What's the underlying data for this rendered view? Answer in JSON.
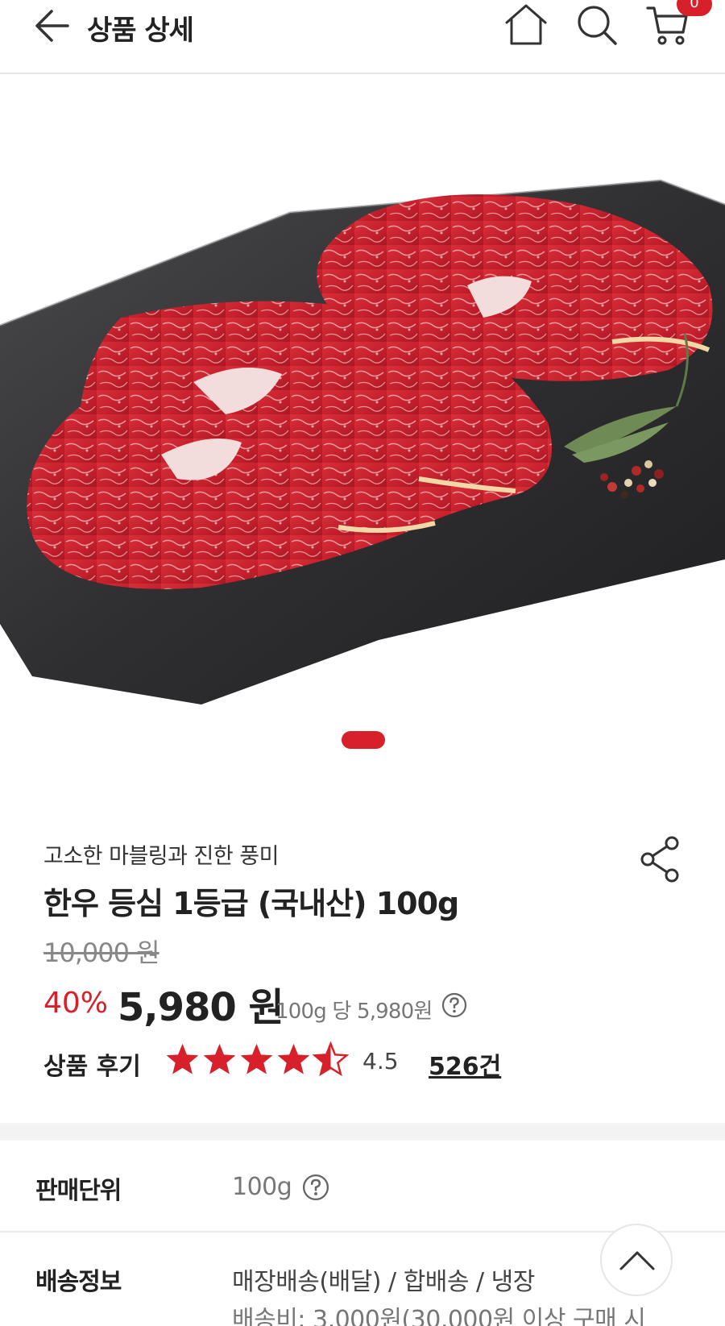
{
  "header": {
    "title": "상품 상세",
    "back_icon": "back-arrow-icon",
    "home_icon": "home-icon",
    "search_icon": "search-icon",
    "cart_icon": "cart-icon",
    "cart_count": "0"
  },
  "gallery": {
    "image": "sliced hanwoo beef on slate board",
    "active_slide": 1
  },
  "product": {
    "subtitle": "고소한 마블링과 진한 풍미",
    "name": "한우 등심 1등급 (국내산) 100g",
    "original_price": "10,000 원",
    "discount_rate": "40%",
    "sale_price": "5,980 원",
    "unit_price": "100g 당 5,980원",
    "share_icon": "share-icon",
    "help_icon": "question-circle-icon"
  },
  "review": {
    "label": "상품 후기",
    "rating": 4.5,
    "rating_text": "4.5",
    "count": "526건"
  },
  "details": {
    "sales_unit_label": "판매단위",
    "sales_unit_value": "100g",
    "delivery_label": "배송정보",
    "delivery_value": "매장배송(배달) / 합배송 / 냉장",
    "delivery_fee": "배송비: 3,000원(30,000원 이상 구매 시"
  },
  "scroll_top_icon": "chevron-up-icon",
  "colors": {
    "accent": "#d8202a",
    "text": "#222222",
    "muted": "#777777"
  }
}
